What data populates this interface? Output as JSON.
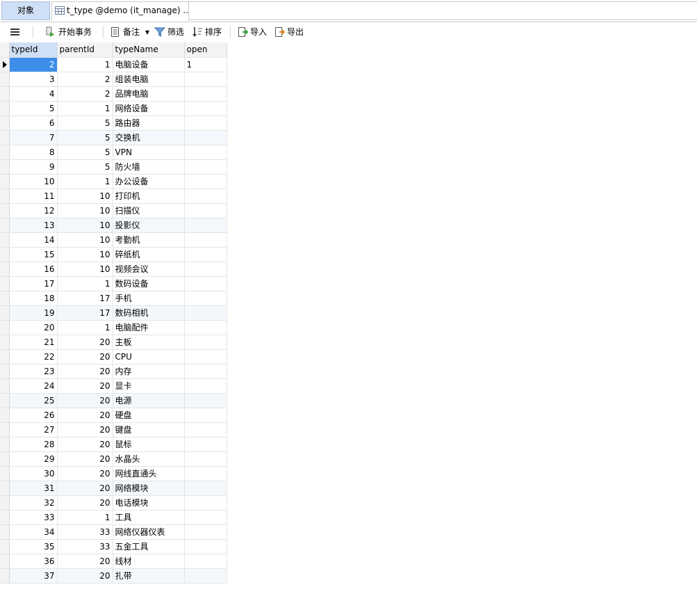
{
  "tabs": {
    "objects_label": "对象",
    "table_label": "t_type @demo (it_manage) ..."
  },
  "toolbar": {
    "menu_icon": "hamburger-icon",
    "begin_transaction": "开始事务",
    "memo": "备注",
    "filter": "筛选",
    "sort": "排序",
    "import": "导入",
    "export": "导出"
  },
  "grid": {
    "columns": [
      "typeId",
      "parentId",
      "typeName",
      "open"
    ],
    "rows": [
      [
        "2",
        "1",
        "电脑设备",
        "1"
      ],
      [
        "3",
        "2",
        "组装电脑",
        ""
      ],
      [
        "4",
        "2",
        "品牌电脑",
        ""
      ],
      [
        "5",
        "1",
        "网络设备",
        ""
      ],
      [
        "6",
        "5",
        "路由器",
        ""
      ],
      [
        "7",
        "5",
        "交换机",
        ""
      ],
      [
        "8",
        "5",
        "VPN",
        ""
      ],
      [
        "9",
        "5",
        "防火墙",
        ""
      ],
      [
        "10",
        "1",
        "办公设备",
        ""
      ],
      [
        "11",
        "10",
        "打印机",
        ""
      ],
      [
        "12",
        "10",
        "扫描仪",
        ""
      ],
      [
        "13",
        "10",
        "投影仪",
        ""
      ],
      [
        "14",
        "10",
        "考勤机",
        ""
      ],
      [
        "15",
        "10",
        "碎纸机",
        ""
      ],
      [
        "16",
        "10",
        "视频会议",
        ""
      ],
      [
        "17",
        "1",
        "数码设备",
        ""
      ],
      [
        "18",
        "17",
        "手机",
        ""
      ],
      [
        "19",
        "17",
        "数码相机",
        ""
      ],
      [
        "20",
        "1",
        "电脑配件",
        ""
      ],
      [
        "21",
        "20",
        "主板",
        ""
      ],
      [
        "22",
        "20",
        "CPU",
        ""
      ],
      [
        "23",
        "20",
        "内存",
        ""
      ],
      [
        "24",
        "20",
        "显卡",
        ""
      ],
      [
        "25",
        "20",
        "电源",
        ""
      ],
      [
        "26",
        "20",
        "硬盘",
        ""
      ],
      [
        "27",
        "20",
        "键盘",
        ""
      ],
      [
        "28",
        "20",
        "鼠标",
        ""
      ],
      [
        "29",
        "20",
        "水晶头",
        ""
      ],
      [
        "30",
        "20",
        "网线直通头",
        ""
      ],
      [
        "31",
        "20",
        "网络模块",
        ""
      ],
      [
        "32",
        "20",
        "电话模块",
        ""
      ],
      [
        "33",
        "1",
        "工具",
        ""
      ],
      [
        "34",
        "33",
        "网络仪器仪表",
        ""
      ],
      [
        "35",
        "33",
        "五金工具",
        ""
      ],
      [
        "36",
        "20",
        "线材",
        ""
      ],
      [
        "37",
        "20",
        "扎带",
        ""
      ]
    ]
  }
}
